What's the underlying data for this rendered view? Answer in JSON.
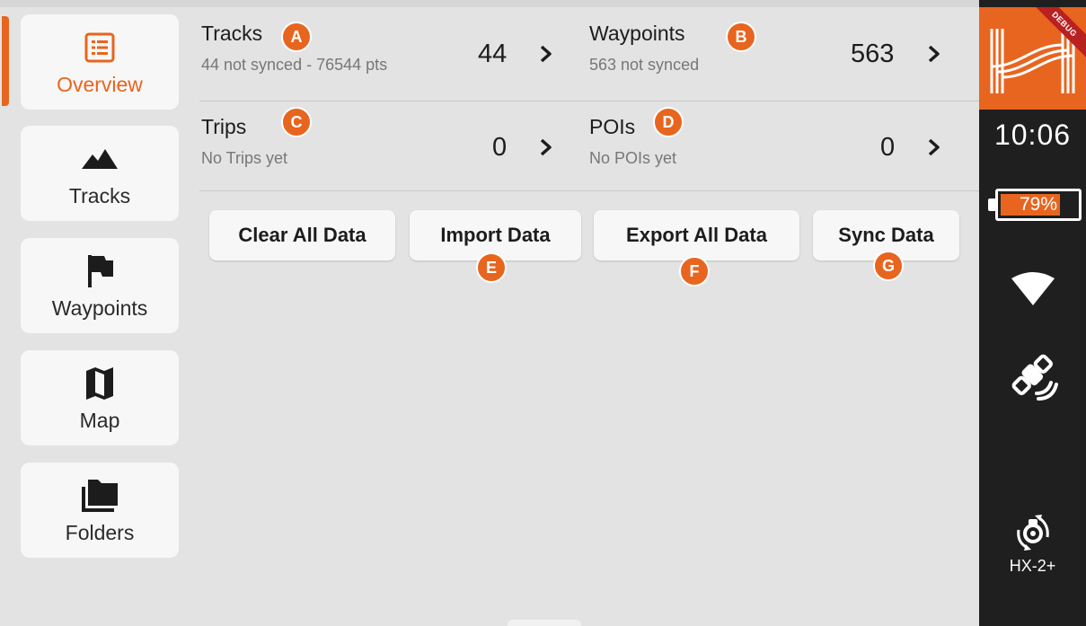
{
  "sidebar": {
    "items": [
      {
        "label": "Overview",
        "icon": "list-icon",
        "active": true
      },
      {
        "label": "Tracks",
        "icon": "mountain-icon",
        "active": false
      },
      {
        "label": "Waypoints",
        "icon": "flag-icon",
        "active": false
      },
      {
        "label": "Map",
        "icon": "map-icon",
        "active": false
      },
      {
        "label": "Folders",
        "icon": "folders-icon",
        "active": false
      }
    ]
  },
  "stats": {
    "tracks": {
      "title": "Tracks",
      "subtitle": "44 not synced - 76544 pts",
      "count": "44",
      "marker": "A"
    },
    "waypoints": {
      "title": "Waypoints",
      "subtitle": "563 not synced",
      "count": "563",
      "marker": "B"
    },
    "trips": {
      "title": "Trips",
      "subtitle": "No Trips yet",
      "count": "0",
      "marker": "C"
    },
    "pois": {
      "title": "POIs",
      "subtitle": "No POIs yet",
      "count": "0",
      "marker": "D"
    }
  },
  "actions": {
    "clear": {
      "label": "Clear All Data"
    },
    "import": {
      "label": "Import Data",
      "marker": "E"
    },
    "export": {
      "label": "Export All Data",
      "marker": "F"
    },
    "sync": {
      "label": "Sync Data",
      "marker": "G"
    }
  },
  "status": {
    "debug_label": "DEBUG",
    "time": "10:06",
    "battery": "79%",
    "battery_level": 0.79,
    "device": "HX-2+"
  },
  "colors": {
    "accent": "#e8651f",
    "background": "#e3e3e3",
    "card": "#f7f7f7",
    "statusbar": "#1f1f1f",
    "debug": "#b92020"
  }
}
